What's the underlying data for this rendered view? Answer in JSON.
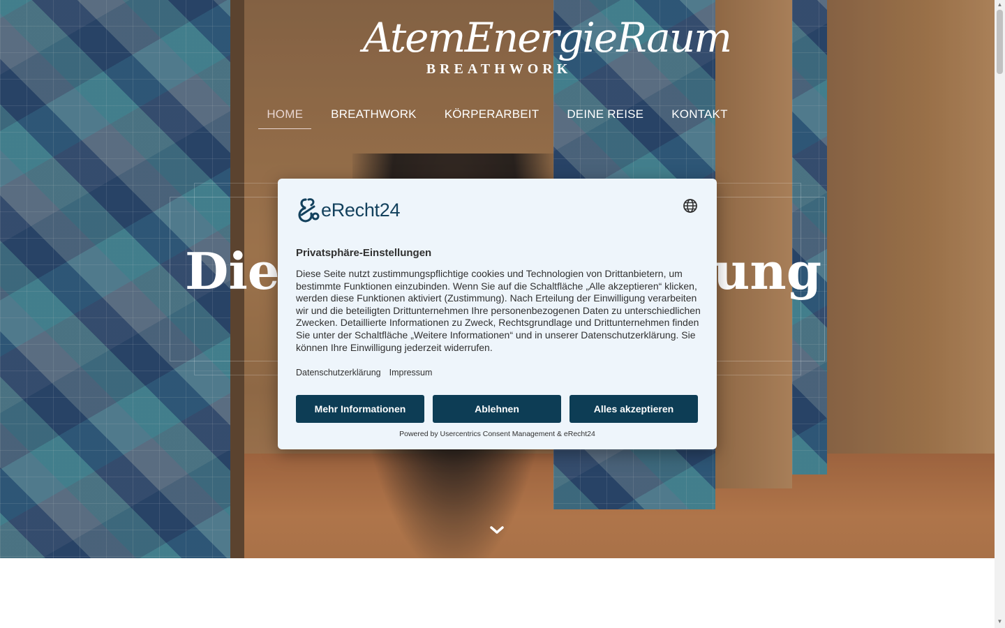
{
  "header": {
    "logo_script": "AtemEnergieRaum",
    "logo_sub": "BREATHWORK"
  },
  "nav": {
    "items": [
      {
        "label": "HOME",
        "active": true
      },
      {
        "label": "BREATHWORK",
        "active": false
      },
      {
        "label": "KÖRPERARBEIT",
        "active": false
      },
      {
        "label": "DEINE REISE",
        "active": false
      },
      {
        "label": "KONTAKT",
        "active": false
      }
    ]
  },
  "hero": {
    "title_left": "Die",
    "title_right": "ung",
    "scroll_icon": "chevron-down-icon"
  },
  "consent": {
    "brand": "eRecht24",
    "brand_icon": "erecht24-logo-icon",
    "language_icon": "globe-icon",
    "title": "Privatsphäre-Einstellungen",
    "body": "Diese Seite nutzt zustimmungspflichtige cookies und Technologien von Drittanbietern, um bestimmte Funktionen einzubinden. Wenn Sie auf die Schaltfläche „Alle akzeptieren“ klicken, werden diese Funktionen aktiviert (Zustimmung). Nach Erteilung der Einwilligung verarbeiten wir und die beteiligten Drittunternehmen Ihre personenbezogenen Daten zu unterschiedlichen Zwecken. Detaillierte Informationen zu Zweck, Rechtsgrundlage und Drittunternehmen finden Sie unter der Schaltfläche „Weitere Informationen“ und in unserer Datenschutzerklärung. Sie können Ihre Einwilligung jederzeit widerrufen.",
    "links": {
      "privacy": "Datenschutzerklärung",
      "imprint": "Impressum"
    },
    "buttons": {
      "more": "Mehr Informationen",
      "deny": "Ablehnen",
      "accept": "Alles akzeptieren"
    },
    "powered_by": "Powered by Usercentrics Consent Management & eRecht24",
    "colors": {
      "button": "#0d3d55",
      "background": "#eef5fb",
      "brand": "#13415d"
    }
  }
}
